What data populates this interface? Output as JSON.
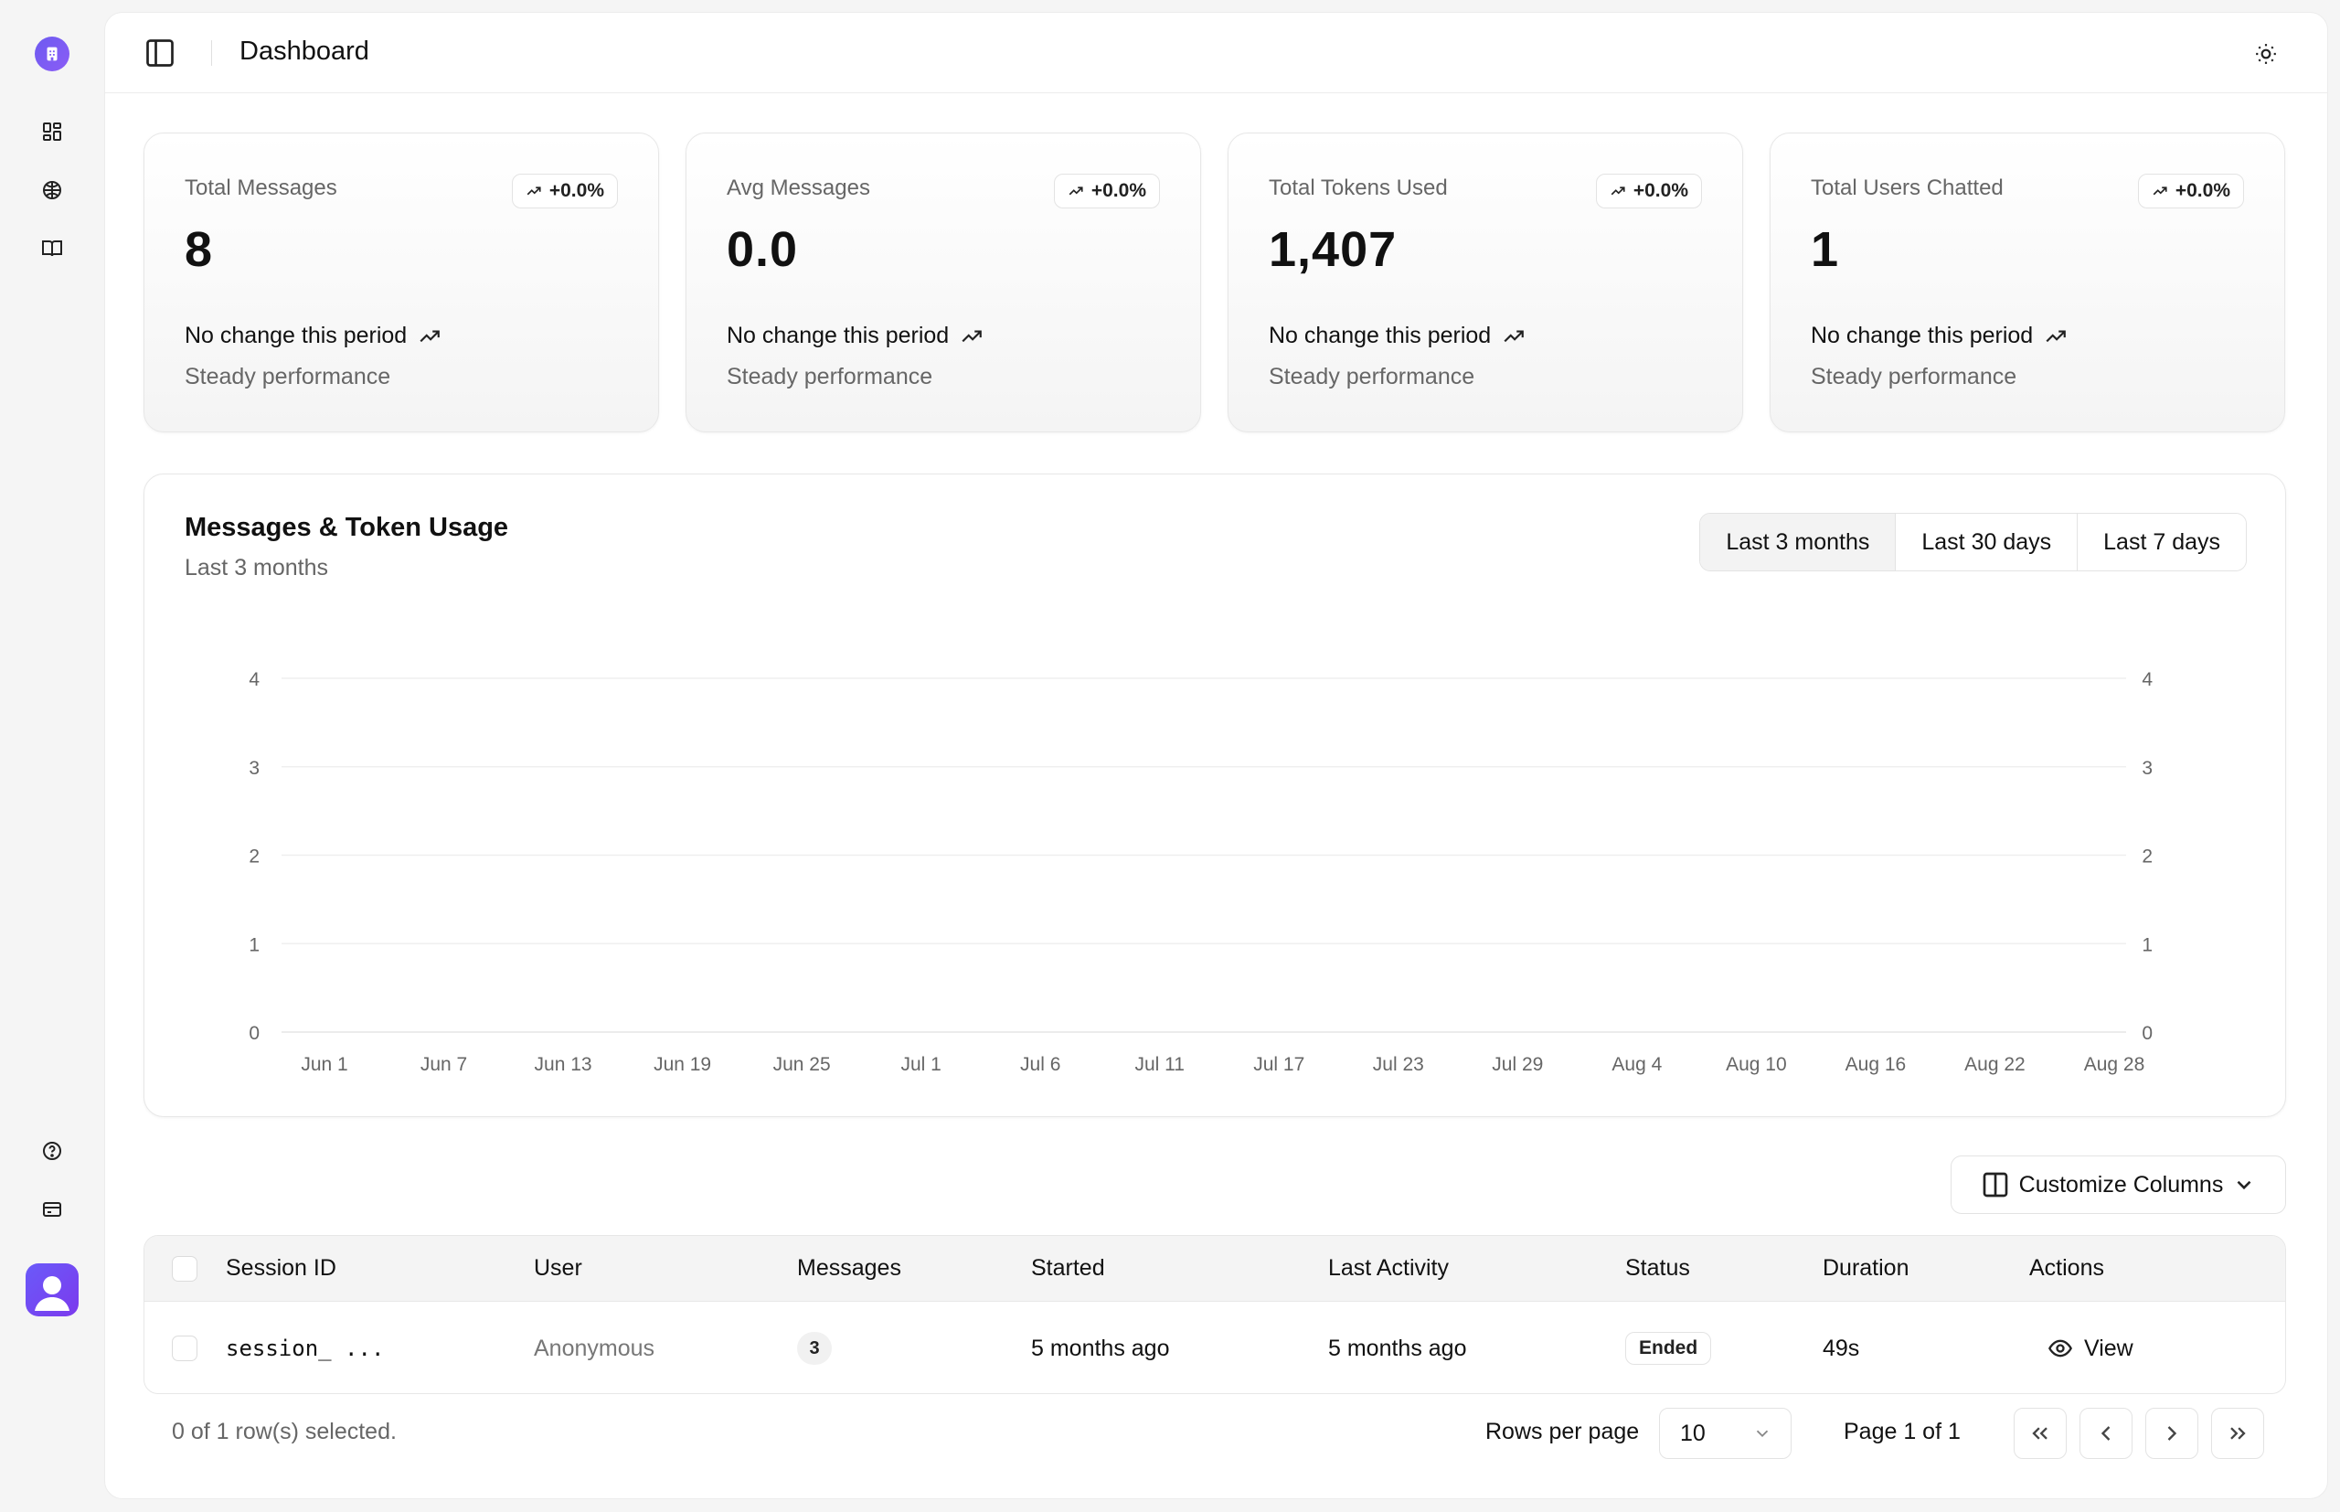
{
  "header": {
    "title": "Dashboard"
  },
  "sidebar": {
    "icons": [
      "dashboard-icon",
      "brain-icon",
      "book-icon",
      "help-icon",
      "billing-icon"
    ]
  },
  "stats": [
    {
      "label": "Total Messages",
      "value": "8",
      "badge": "+0.0%",
      "foot": "No change this period",
      "sub": "Steady performance"
    },
    {
      "label": "Avg Messages",
      "value": "0.0",
      "badge": "+0.0%",
      "foot": "No change this period",
      "sub": "Steady performance"
    },
    {
      "label": "Total Tokens Used",
      "value": "1,407",
      "badge": "+0.0%",
      "foot": "No change this period",
      "sub": "Steady performance"
    },
    {
      "label": "Total Users Chatted",
      "value": "1",
      "badge": "+0.0%",
      "foot": "No change this period",
      "sub": "Steady performance"
    }
  ],
  "chart_section": {
    "title": "Messages & Token Usage",
    "subtitle": "Last 3 months",
    "ranges": [
      "Last 3 months",
      "Last 30 days",
      "Last 7 days"
    ],
    "active_range": "Last 3 months"
  },
  "chart_data": {
    "type": "area",
    "title": "Messages & Token Usage",
    "categories": [
      "Jun 1",
      "Jun 7",
      "Jun 13",
      "Jun 19",
      "Jun 25",
      "Jul 1",
      "Jul 6",
      "Jul 11",
      "Jul 17",
      "Jul 23",
      "Jul 29",
      "Aug 4",
      "Aug 10",
      "Aug 16",
      "Aug 22",
      "Aug 28"
    ],
    "y_left_ticks": [
      0,
      1,
      2,
      3,
      4
    ],
    "y_right_ticks": [
      0,
      1,
      2,
      3,
      4
    ],
    "ylim": [
      0,
      4
    ],
    "grid": true,
    "series": []
  },
  "table": {
    "customize_label": "Customize Columns",
    "columns": [
      "Session ID",
      "User",
      "Messages",
      "Started",
      "Last Activity",
      "Status",
      "Duration",
      "Actions"
    ],
    "rows": [
      {
        "session_id": "session_ ...",
        "user": "Anonymous",
        "messages": "3",
        "started": "5 months ago",
        "last_activity": "5 months ago",
        "status": "Ended",
        "duration": "49s",
        "action": "View"
      }
    ]
  },
  "pagination": {
    "selected_text": "0 of 1 row(s) selected.",
    "rows_per_page_label": "Rows per page",
    "rows_per_page": "10",
    "page_text": "Page 1 of 1"
  }
}
